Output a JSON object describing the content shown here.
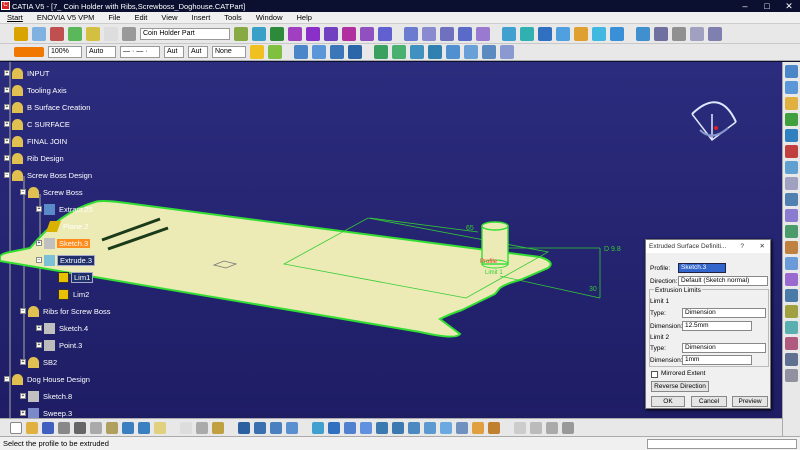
{
  "window": {
    "title": "CATIA V5 - [7_ Coin Holder with Ribs,Screwboss_Doghouse.CATPart]",
    "controls": [
      "–",
      "□",
      "✕"
    ]
  },
  "menu": [
    "Start",
    "ENOVIA V5 VPM",
    "File",
    "Edit",
    "View",
    "Insert",
    "Tools",
    "Window",
    "Help"
  ],
  "toolbar": {
    "part_selector": "Coin Holder Part",
    "zoom": "100%",
    "line_weight": "Auto",
    "line_type": "— · — ·",
    "layer_a": "Aut",
    "layer_b": "Aut",
    "render_mode": "None"
  },
  "tree": [
    {
      "label": "INPUT"
    },
    {
      "label": "Tooling Axis"
    },
    {
      "label": "B Surface Creation"
    },
    {
      "label": "C SURFACE"
    },
    {
      "label": "FINAL JOIN"
    },
    {
      "label": "Rib Design"
    },
    {
      "label": "Screw Boss Design"
    },
    {
      "label": "Screw Boss"
    },
    {
      "label": "Extract.25"
    },
    {
      "label": "Plane.2"
    },
    {
      "label": "Sketch.3"
    },
    {
      "label": "Extrude.3"
    },
    {
      "label": "Lim1"
    },
    {
      "label": "Lim2"
    },
    {
      "label": "Ribs for Screw Boss"
    },
    {
      "label": "Sketch.4"
    },
    {
      "label": "Point.3"
    },
    {
      "label": "SB2"
    },
    {
      "label": "Dog House Design"
    },
    {
      "label": "Sketch.8"
    },
    {
      "label": "Sweep.3"
    }
  ],
  "annotations": {
    "dim_65": "65",
    "dim_d98": "D 9.8",
    "dim_30": "30",
    "profile": "Profile",
    "limit1": "Limit 1"
  },
  "dialog": {
    "title": "Extruded Surface Definiti...",
    "help": "?",
    "close": "✕",
    "profile_label": "Profile:",
    "profile_value": "Sketch.3",
    "direction_label": "Direction:",
    "direction_value": "Default (Sketch normal)",
    "extrusion_limits": "Extrusion Limits",
    "limit1": "Limit 1",
    "limit1_type_label": "Type:",
    "limit1_type": "Dimension",
    "limit1_dim_label": "Dimension:",
    "limit1_dim": "12.5mm",
    "limit2": "Limit 2",
    "limit2_type_label": "Type:",
    "limit2_type": "Dimension",
    "limit2_dim_label": "Dimension:",
    "limit2_dim": "1mm",
    "mirrored": "Mirrored Extent",
    "mirrored_checked": false,
    "reverse": "Reverse Direction",
    "ok": "OK",
    "cancel": "Cancel",
    "preview": "Preview"
  },
  "status": {
    "message": "Select the profile to be extruded"
  }
}
